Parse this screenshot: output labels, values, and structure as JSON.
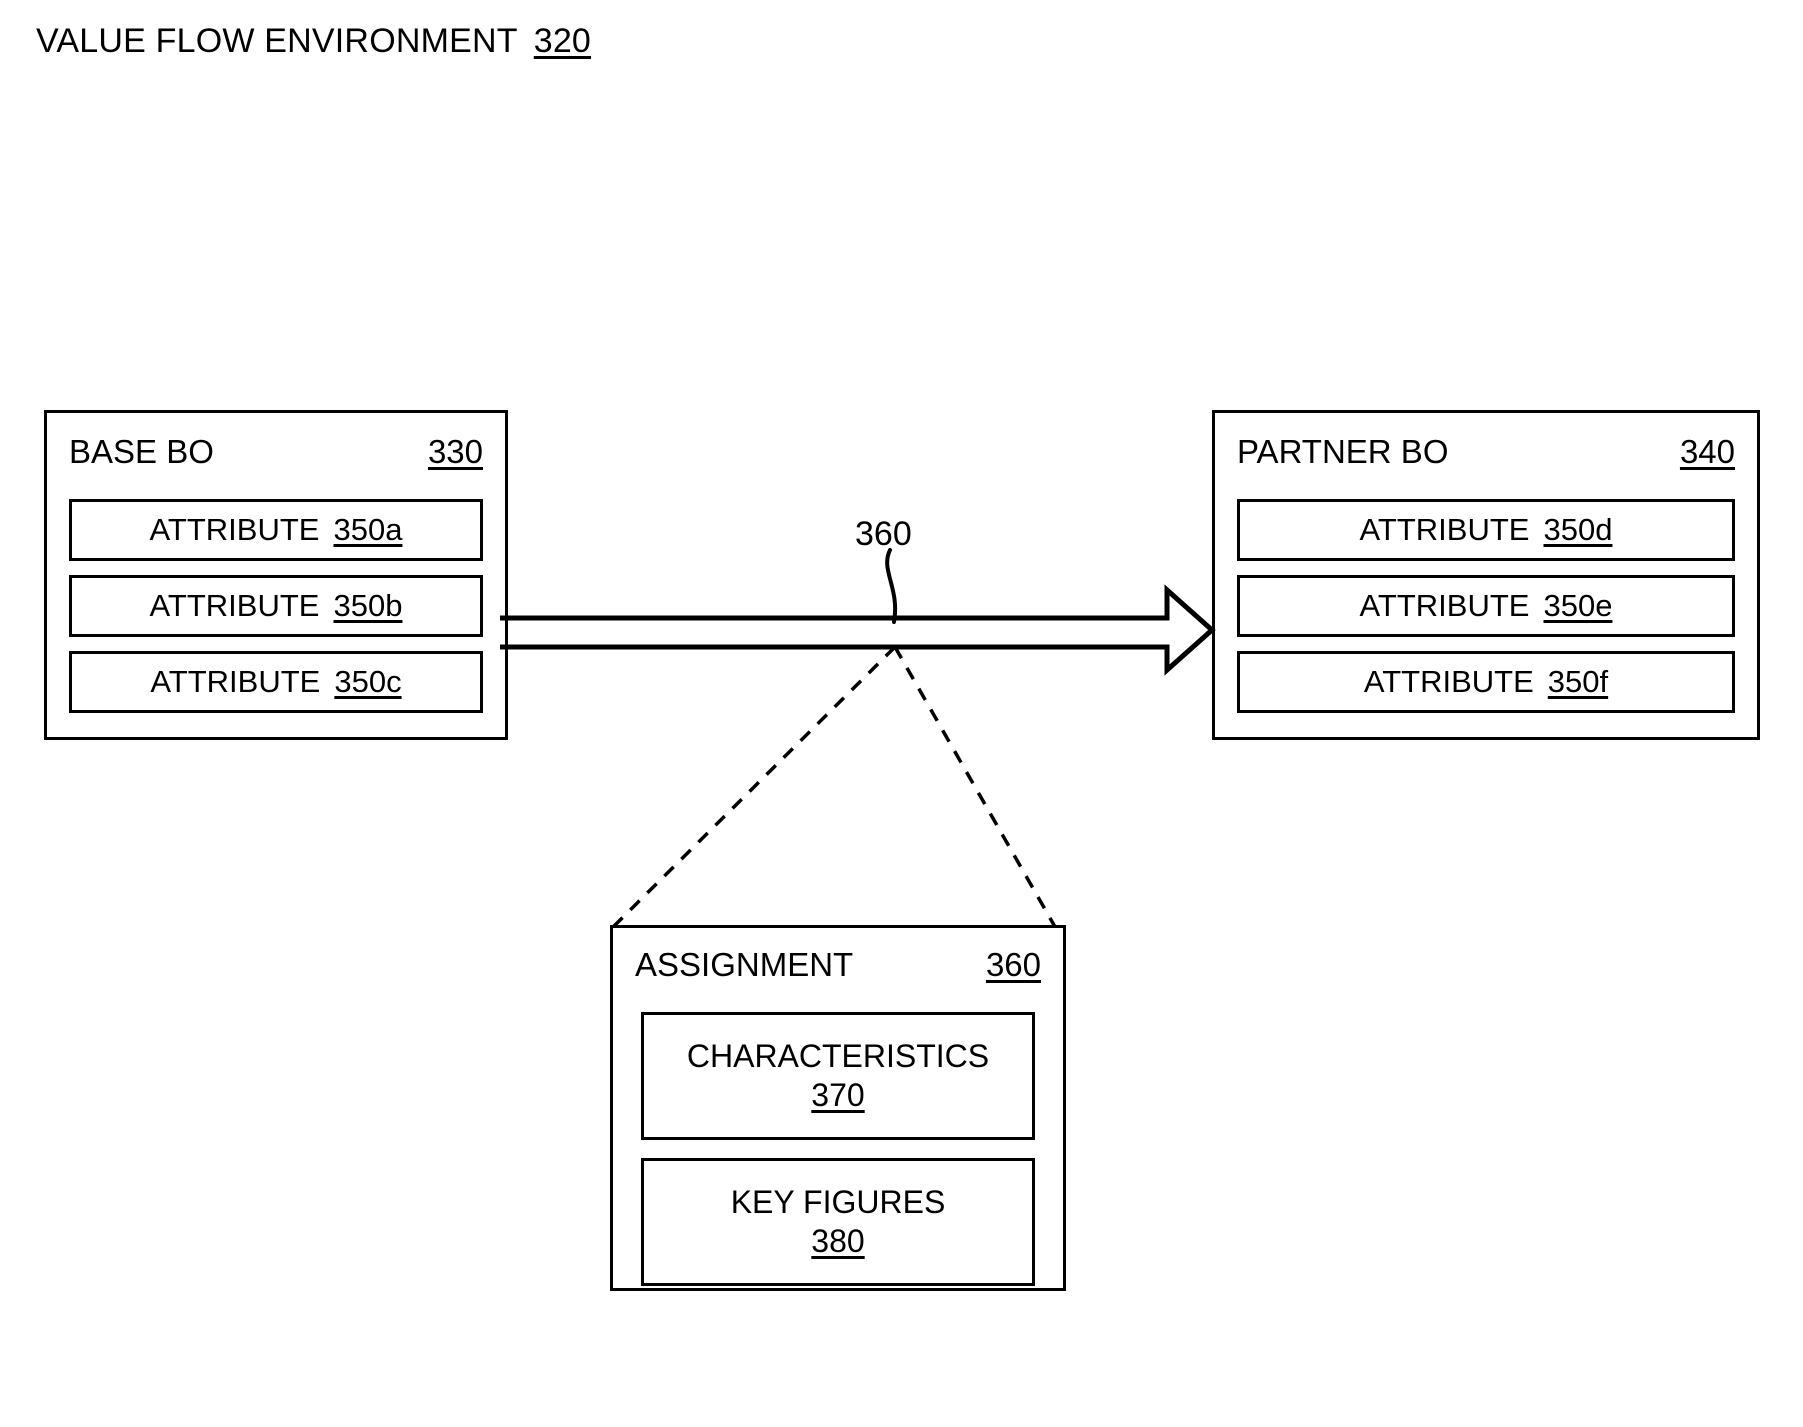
{
  "figure": {
    "title_label": "VALUE FLOW ENVIRONMENT",
    "title_ref": "320"
  },
  "base_bo": {
    "title": "BASE BO",
    "ref": "330",
    "attributes": [
      {
        "label": "ATTRIBUTE",
        "ref": "350a"
      },
      {
        "label": "ATTRIBUTE",
        "ref": "350b"
      },
      {
        "label": "ATTRIBUTE",
        "ref": "350c"
      }
    ]
  },
  "partner_bo": {
    "title": "PARTNER BO",
    "ref": "340",
    "attributes": [
      {
        "label": "ATTRIBUTE",
        "ref": "350d"
      },
      {
        "label": "ATTRIBUTE",
        "ref": "350e"
      },
      {
        "label": "ATTRIBUTE",
        "ref": "350f"
      }
    ]
  },
  "flow_arrow": {
    "ref": "360",
    "direction": "base-bo-to-partner-bo"
  },
  "assignment": {
    "title": "ASSIGNMENT",
    "ref": "360",
    "sections": [
      {
        "label": "CHARACTERISTICS",
        "ref": "370"
      },
      {
        "label": "KEY FIGURES",
        "ref": "380"
      }
    ]
  }
}
